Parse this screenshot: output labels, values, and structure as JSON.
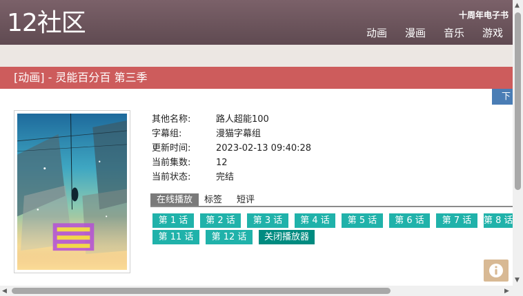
{
  "header": {
    "logo": "12社区",
    "ebook_link": "十周年电子书",
    "nav": [
      "动画",
      "漫画",
      "音乐",
      "游戏"
    ]
  },
  "title_bar": "[动画] - 灵能百分百 第三季",
  "download_button": "下",
  "info": [
    {
      "key": "其他名称:",
      "value": "路人超能100"
    },
    {
      "key": "字幕组:",
      "value": "漫猫字幕组"
    },
    {
      "key": "更新时间:",
      "value": "2023-02-13 09:40:28"
    },
    {
      "key": "当前集数:",
      "value": "12"
    },
    {
      "key": "当前状态:",
      "value": "完结"
    }
  ],
  "tabs": [
    "在线播放",
    "标签",
    "短评"
  ],
  "episodes": [
    "第 1 话",
    "第 2 话",
    "第 3 话",
    "第 4 话",
    "第 5 话",
    "第 6 话",
    "第 7 话",
    "第 8 话",
    "第 11 话",
    "第 12 话"
  ],
  "close_player": "关闭播放器",
  "colors": {
    "header": "#6b545b",
    "title_bar": "#cd5c5c",
    "episode_button": "#20b2aa",
    "close_button": "#008b80",
    "download_button": "#4a7db5"
  }
}
